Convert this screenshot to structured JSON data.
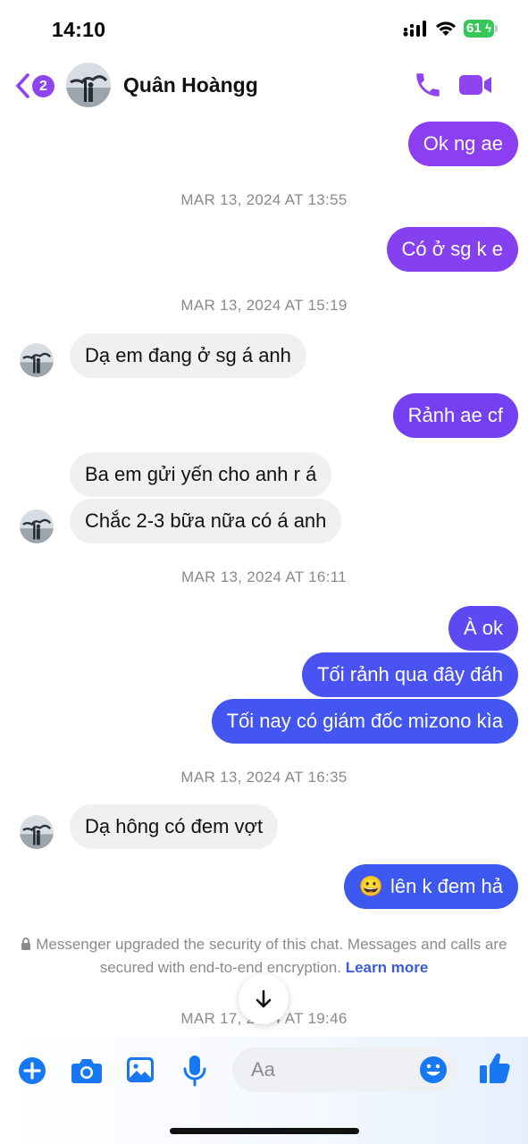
{
  "status": {
    "time": "14:10",
    "battery": "61"
  },
  "header": {
    "back_badge": "2",
    "contact_name": "Quân Hoàngg"
  },
  "messages": [
    {
      "dir": "out",
      "text": "Ok ng ae"
    },
    {
      "dir": "out",
      "text": "Có ở sg k e"
    },
    {
      "dir": "in",
      "text": "Dạ em đang ở sg á anh"
    },
    {
      "dir": "out",
      "text": "Rảnh ae cf"
    },
    {
      "dir": "in",
      "text": "Ba em gửi yến cho anh r á"
    },
    {
      "dir": "in",
      "text": "Chắc 2-3 bữa nữa có á anh"
    },
    {
      "dir": "out",
      "text": "À ok"
    },
    {
      "dir": "out",
      "text": "Tối rảnh qua đây đáh"
    },
    {
      "dir": "out",
      "text": "Tối nay có giám đốc mizono kìa"
    },
    {
      "dir": "in",
      "text": "Dạ hông có đem vợt"
    },
    {
      "dir": "out",
      "emoji": "😀",
      "text": "lên k đem hả"
    }
  ],
  "timestamps": [
    "MAR 13, 2024 AT 13:55",
    "MAR 13, 2024 AT 15:19",
    "MAR 13, 2024 AT 16:11",
    "MAR 13, 2024 AT 16:35",
    "MAR 17, 2024 AT 19:46"
  ],
  "security_notice": {
    "text": "Messenger upgraded the security of this chat. Messages and calls are secured with end-to-end encryption.",
    "link": "Learn more"
  },
  "composer": {
    "placeholder": "Aa"
  },
  "colors": {
    "accent_purple": "#8e44ef",
    "bubble_out_purple": "#8c3ff0",
    "bubble_out_violet": "#6a41f2",
    "bubble_out_blue": "#3c58f0",
    "composer_blue": "#1877f2"
  },
  "icons": [
    "signal-icon",
    "wifi-icon",
    "battery-icon",
    "back-chevron-icon",
    "phone-icon",
    "video-camera-icon",
    "arrow-down-icon",
    "lock-icon",
    "plus-icon",
    "camera-icon",
    "image-icon",
    "microphone-icon",
    "emoji-icon",
    "thumbs-up-icon"
  ]
}
